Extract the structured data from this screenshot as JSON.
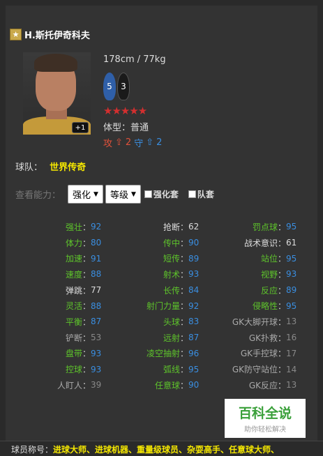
{
  "player": {
    "name": "H.斯托伊奇科夫",
    "overall_badge": "+1",
    "size": "178cm / 77kg",
    "foot_left": "5",
    "foot_right": "3",
    "stars": "★★★★★",
    "body_type": "体型：普通",
    "workrate": {
      "atk_label": "攻",
      "atk_value": "2",
      "def_label": "守",
      "def_value": "2"
    },
    "team_label": "球队：",
    "team_value": "世界传奇"
  },
  "ability_filter": {
    "label": "查看能力：",
    "select1": "强化",
    "select2": "等级",
    "check1": "强化套",
    "check2": "队套"
  },
  "stats": [
    {
      "label": "强壮",
      "value": "92",
      "lc": "g",
      "vc": "b"
    },
    {
      "label": "抢断",
      "value": "62",
      "lc": "w",
      "vc": "w"
    },
    {
      "label": "罚点球",
      "value": "95",
      "lc": "g",
      "vc": "b"
    },
    {
      "label": "体力",
      "value": "80",
      "lc": "g",
      "vc": "b"
    },
    {
      "label": "传中",
      "value": "90",
      "lc": "g",
      "vc": "b"
    },
    {
      "label": "战术意识",
      "value": "61",
      "lc": "w",
      "vc": "w"
    },
    {
      "label": "加速",
      "value": "91",
      "lc": "g",
      "vc": "b"
    },
    {
      "label": "短传",
      "value": "89",
      "lc": "g",
      "vc": "b"
    },
    {
      "label": "站位",
      "value": "95",
      "lc": "g",
      "vc": "b"
    },
    {
      "label": "速度",
      "value": "88",
      "lc": "g",
      "vc": "b"
    },
    {
      "label": "射术",
      "value": "93",
      "lc": "g",
      "vc": "b"
    },
    {
      "label": "视野",
      "value": "93",
      "lc": "g",
      "vc": "b"
    },
    {
      "label": "弹跳",
      "value": "77",
      "lc": "w",
      "vc": "w"
    },
    {
      "label": "长传",
      "value": "84",
      "lc": "g",
      "vc": "b"
    },
    {
      "label": "反应",
      "value": "89",
      "lc": "g",
      "vc": "b"
    },
    {
      "label": "灵活",
      "value": "88",
      "lc": "g",
      "vc": "b"
    },
    {
      "label": "射门力量",
      "value": "92",
      "lc": "g",
      "vc": "b"
    },
    {
      "label": "侵略性",
      "value": "95",
      "lc": "g",
      "vc": "b"
    },
    {
      "label": "平衡",
      "value": "87",
      "lc": "g",
      "vc": "b"
    },
    {
      "label": "头球",
      "value": "83",
      "lc": "g",
      "vc": "b"
    },
    {
      "label": "GK大脚开球",
      "value": "13",
      "lc": "y",
      "vc": "gr"
    },
    {
      "label": "铲断",
      "value": "53",
      "lc": "y",
      "vc": "gr"
    },
    {
      "label": "远射",
      "value": "87",
      "lc": "g",
      "vc": "b"
    },
    {
      "label": "GK扑救",
      "value": "16",
      "lc": "y",
      "vc": "gr"
    },
    {
      "label": "盘带",
      "value": "93",
      "lc": "g",
      "vc": "b"
    },
    {
      "label": "凌空抽射",
      "value": "96",
      "lc": "g",
      "vc": "b"
    },
    {
      "label": "GK手控球",
      "value": "17",
      "lc": "y",
      "vc": "gr"
    },
    {
      "label": "控球",
      "value": "93",
      "lc": "g",
      "vc": "b"
    },
    {
      "label": "弧线",
      "value": "95",
      "lc": "g",
      "vc": "b"
    },
    {
      "label": "GK防守站位",
      "value": "14",
      "lc": "y",
      "vc": "gr"
    },
    {
      "label": "人盯人",
      "value": "39",
      "lc": "y",
      "vc": "gr"
    },
    {
      "label": "任意球",
      "value": "90",
      "lc": "g",
      "vc": "b"
    },
    {
      "label": "GK反应",
      "value": "13",
      "lc": "y",
      "vc": "gr"
    }
  ],
  "watermark": {
    "title": "百科全说",
    "subtitle": "助你轻松解决"
  },
  "titles": {
    "label": "球员称号：",
    "value": "进球大师、进球机器、重量级球员、杂耍高手、任意球大师、"
  },
  "colors": {
    "green": "#5ec42b",
    "blue": "#3a8ee0",
    "yellow": "#f6e800",
    "red": "#d32f2f"
  }
}
